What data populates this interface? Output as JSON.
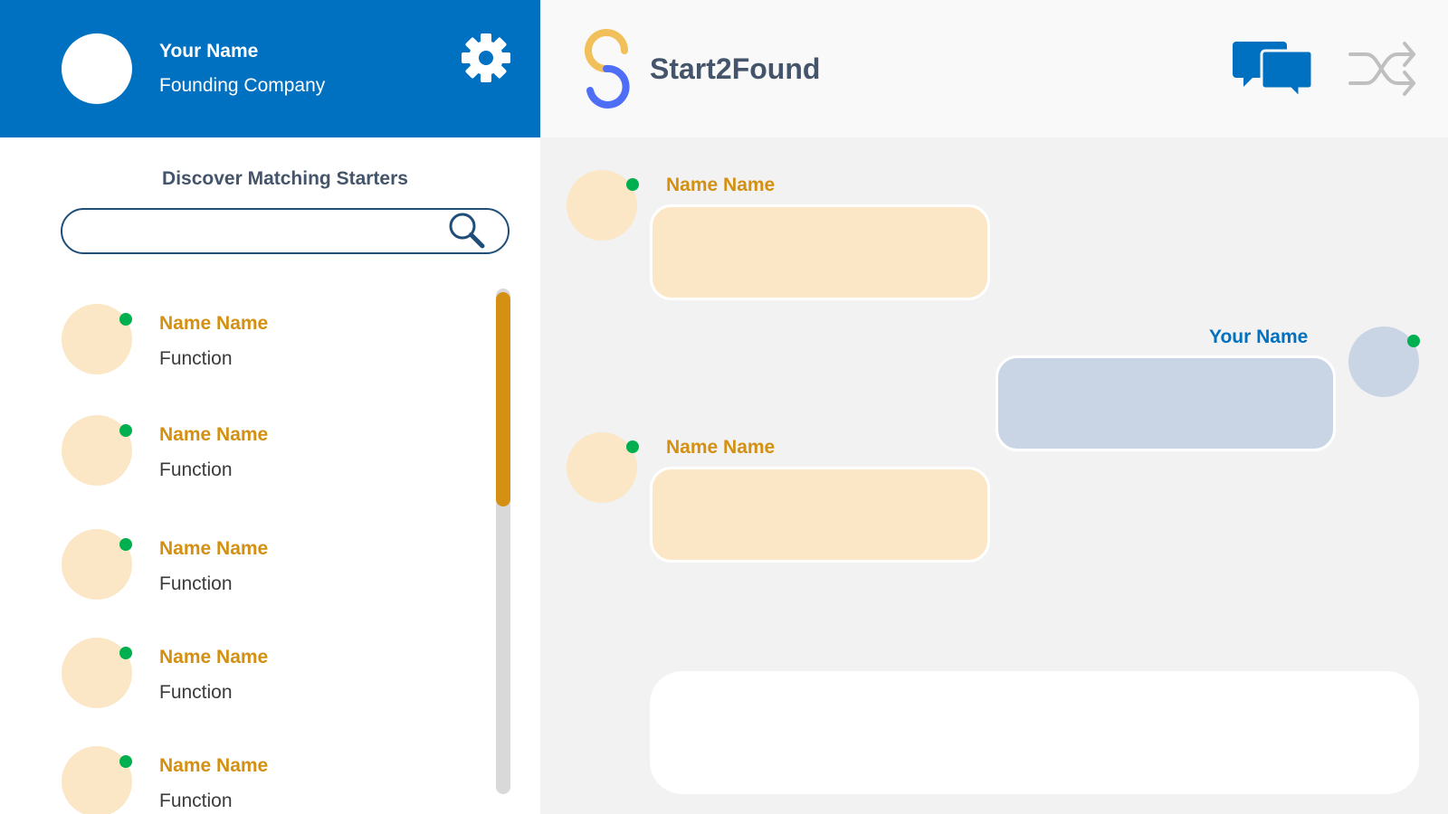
{
  "profile": {
    "name": "Your Name",
    "company": "Founding Company"
  },
  "discover": {
    "title": "Discover Matching Starters",
    "search_value": "",
    "search_placeholder": ""
  },
  "starters": [
    {
      "name": "Name Name",
      "function": "Function",
      "online": true
    },
    {
      "name": "Name Name",
      "function": "Function",
      "online": true
    },
    {
      "name": "Name Name",
      "function": "Function",
      "online": true
    },
    {
      "name": "Name Name",
      "function": "Function",
      "online": true
    },
    {
      "name": "Name Name",
      "function": "Function",
      "online": true
    }
  ],
  "header": {
    "brand": "Start2Found",
    "icons": [
      "chat-icon",
      "shuffle-icon"
    ]
  },
  "messages": [
    {
      "sender": "Name Name",
      "side": "left",
      "text": ""
    },
    {
      "sender": "Your Name",
      "side": "right",
      "text": ""
    },
    {
      "sender": "Name Name",
      "side": "left",
      "text": ""
    }
  ],
  "composer": {
    "value": "",
    "placeholder": ""
  },
  "colors": {
    "primary_blue": "#0070c0",
    "accent_orange": "#d39012",
    "online_green": "#00b050",
    "other_bubble": "#fbe7c6",
    "own_bubble": "#c9d5e5",
    "logo_yellow": "#f2c05a",
    "logo_blue": "#4f6ef7"
  }
}
